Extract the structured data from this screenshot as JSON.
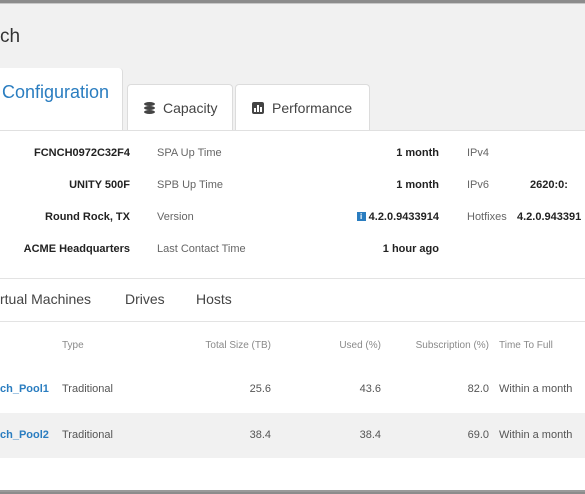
{
  "header": {
    "title": "ch"
  },
  "tabs": {
    "configuration": "Configuration",
    "capacity": "Capacity",
    "performance": "Performance"
  },
  "properties": [
    {
      "value": "FCNCH0972C32F4",
      "key2": "SPA Up Time",
      "value2": "1 month",
      "key3": "IPv4",
      "value3": ""
    },
    {
      "value": "UNITY 500F",
      "key2": "SPB Up Time",
      "value2": "1 month",
      "key3": "IPv6",
      "value3": "2620:0:"
    },
    {
      "value": "Round Rock, TX",
      "key2": "Version",
      "value2": "4.2.0.9433914",
      "key3": "Hotfixes",
      "value3": "4.2.0.943391"
    },
    {
      "value": "ACME Headquarters",
      "key2": "Last Contact Time",
      "value2": "1 hour ago",
      "key3": "",
      "value3": ""
    }
  ],
  "subtabs": [
    "rtual Machines",
    "Drives",
    "Hosts"
  ],
  "table": {
    "headers": {
      "type": "Type",
      "total_size": "Total Size (TB)",
      "used": "Used (%)",
      "subscription": "Subscription (%)",
      "time_to_full": "Time To Full"
    },
    "rows": [
      {
        "name": "ch_Pool1",
        "type": "Traditional",
        "total_size": "25.6",
        "used": "43.6",
        "subscription": "82.0",
        "time_to_full": "Within a month"
      },
      {
        "name": "ch_Pool2",
        "type": "Traditional",
        "total_size": "38.4",
        "used": "38.4",
        "subscription": "69.0",
        "time_to_full": "Within a month"
      }
    ]
  },
  "icons": {
    "capacity": "database-icon",
    "performance": "bar-chart-icon",
    "version": "info-icon"
  },
  "colors": {
    "accent": "#2a7dc0",
    "header_bg": "#f1f1f1"
  }
}
